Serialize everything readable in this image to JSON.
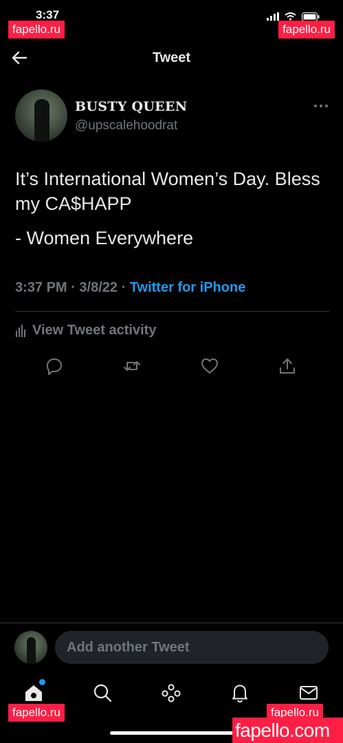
{
  "status_bar": {
    "time": "3:37"
  },
  "watermark": {
    "small": "fapello.ru",
    "large": "fapello.com"
  },
  "header": {
    "title": "Tweet"
  },
  "author": {
    "display_name": "BUSTY QUEEN",
    "handle": "@upscalehoodrat"
  },
  "tweet": {
    "lines": [
      "It’s International Women’s Day. Bless my CA$HAPP",
      "- Women Everywhere"
    ],
    "time": "3:37 PM",
    "date": "3/8/22",
    "source": "Twitter for iPhone",
    "separator": "·"
  },
  "activity": {
    "label": "View Tweet activity"
  },
  "actions": [
    "reply-icon",
    "retweet-icon",
    "like-icon",
    "share-icon"
  ],
  "composer": {
    "placeholder": "Add another Tweet"
  },
  "tabs": [
    "home-icon",
    "search-icon",
    "spaces-icon",
    "notifications-icon",
    "messages-icon"
  ],
  "colors": {
    "accent": "#1d9bf0",
    "muted": "#71767b",
    "text": "#e7e9ea",
    "background": "#000000",
    "watermark": "#ff1f45"
  }
}
